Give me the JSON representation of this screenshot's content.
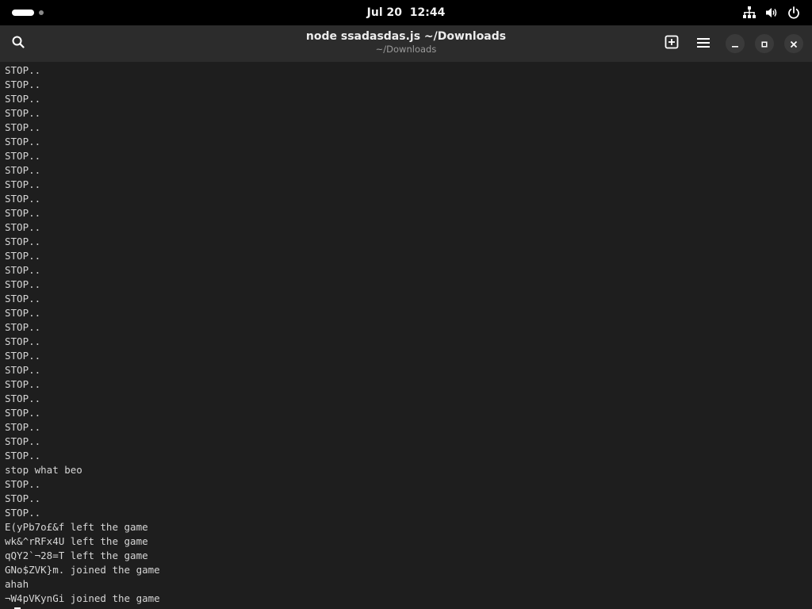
{
  "topbar": {
    "clock": "Jul 20  12:44",
    "icons": [
      "network-icon",
      "volume-icon",
      "power-icon"
    ]
  },
  "window": {
    "title": "node ssadasdas.js ~/Downloads",
    "subtitle": "~/Downloads",
    "icons": [
      "search-icon",
      "new-tab-icon",
      "hamburger-menu-icon",
      "minimize-icon",
      "maximize-icon",
      "close-icon"
    ]
  },
  "terminal": {
    "lines": [
      "STOP..",
      "STOP..",
      "STOP..",
      "STOP..",
      "STOP..",
      "STOP..",
      "STOP..",
      "STOP..",
      "STOP..",
      "STOP..",
      "STOP..",
      "STOP..",
      "STOP..",
      "STOP..",
      "STOP..",
      "STOP..",
      "STOP..",
      "STOP..",
      "STOP..",
      "STOP..",
      "STOP..",
      "STOP..",
      "STOP..",
      "STOP..",
      "STOP..",
      "STOP..",
      "STOP..",
      "STOP..",
      "stop what beo",
      "STOP..",
      "STOP..",
      "STOP..",
      "E(yPb7o£&f left the game",
      "wk&^rRFx4U left the game",
      "qQY2`¬28=T left the game",
      "GNo$ZVK}m. joined the game",
      "ahah",
      "¬W4pVKynGi joined the game"
    ],
    "prompt": ">"
  },
  "colors": {
    "topbar_bg": "#000000",
    "headerbar_bg": "#2c2c2c",
    "terminal_bg": "#1e1e1e",
    "terminal_fg": "#d6d6d6"
  }
}
